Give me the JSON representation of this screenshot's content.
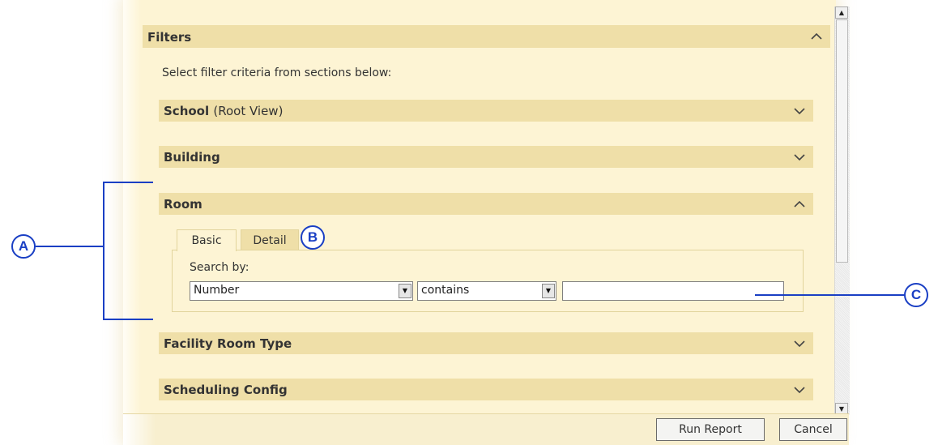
{
  "filters": {
    "title": "Filters",
    "instructions": "Select filter criteria from sections below:"
  },
  "sections": [
    {
      "title": "School",
      "subtitle": "(Root View)",
      "expanded": false
    },
    {
      "title": "Building",
      "subtitle": "",
      "expanded": false
    },
    {
      "title": "Room",
      "subtitle": "",
      "expanded": true
    },
    {
      "title": "Facility Room Type",
      "subtitle": "",
      "expanded": false
    },
    {
      "title": "Scheduling Config",
      "subtitle": "",
      "expanded": false
    }
  ],
  "room": {
    "tabs": [
      {
        "label": "Basic",
        "active": true
      },
      {
        "label": "Detail",
        "active": false
      }
    ],
    "search_label": "Search by:",
    "field_select_value": "Number",
    "operator_select_value": "contains",
    "search_value": ""
  },
  "buttons": {
    "run_report": "Run Report",
    "cancel": "Cancel"
  },
  "callouts": {
    "a": "A",
    "b": "B",
    "c": "C"
  },
  "colors": {
    "panel": "#fdf4d4",
    "header": "#efdfa8",
    "callout": "#1a3fc4"
  },
  "icons": {
    "collapse": "chevron-up-icon",
    "expand": "chevron-down-icon",
    "dropdown": "dropdown-arrow-icon"
  }
}
